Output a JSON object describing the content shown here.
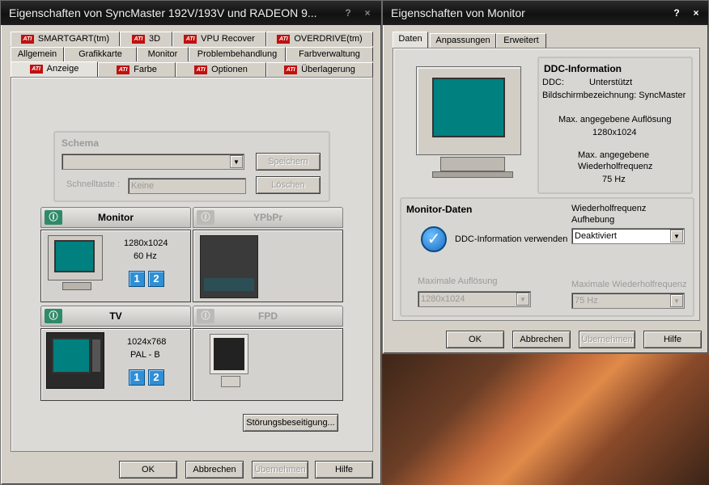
{
  "left_window": {
    "title": "Eigenschaften von  SyncMaster 192V/193V  und RADEON 9...",
    "help_btn": "?",
    "close_btn": "×",
    "tabs_row1": [
      "SMARTGART(tm)",
      "3D",
      "VPU Recover",
      "OVERDRIVE(tm)"
    ],
    "tabs_row2": [
      "Allgemein",
      "Grafikkarte",
      "Monitor",
      "Problembehandlung",
      "Farbverwaltung"
    ],
    "tabs_row3": [
      "Anzeige",
      "Farbe",
      "Optionen",
      "Überlagerung"
    ],
    "ati_logo": "ATI",
    "schema": {
      "title": "Schema",
      "save_btn": "Speichern",
      "hotkey_label": "Schnelltaste :",
      "hotkey_value": "Keine",
      "delete_btn": "Löschen"
    },
    "devices": {
      "monitor": {
        "name": "Monitor",
        "resolution": "1280x1024",
        "refresh": "60 Hz",
        "badge1": "1",
        "badge2": "2"
      },
      "ypbpr": {
        "name": "YPbPr"
      },
      "tv": {
        "name": "TV",
        "resolution": "1024x768",
        "standard": "PAL - B",
        "badge1": "1",
        "badge2": "2"
      },
      "fpd": {
        "name": "FPD"
      }
    },
    "power_symbol": "Ⓘ",
    "troubleshoot_btn": "Störungsbeseitigung...",
    "buttons": {
      "ok": "OK",
      "cancel": "Abbrechen",
      "apply": "Übernehmen",
      "help": "Hilfe"
    }
  },
  "right_window": {
    "title": "Eigenschaften von Monitor",
    "help_btn": "?",
    "close_btn": "×",
    "tabs": [
      "Daten",
      "Anpassungen",
      "Erweitert"
    ],
    "ddc": {
      "title": "DDC-Information",
      "ddc_label": "DDC:",
      "ddc_value": "Unterstützt",
      "screen_name": "Bildschirmbezeichnung: SyncMaster",
      "max_res_label": "Max. angegebene Auflösung",
      "max_res_value": "1280x1024",
      "max_freq_label1": "Max. angegebene",
      "max_freq_label2": "Wiederholfrequenz",
      "max_freq_value": "75 Hz"
    },
    "monitor_data": {
      "title": "Monitor-Daten",
      "use_ddc": "DDC-Information verwenden",
      "refresh_override_label1": "Wiederholfrequenz",
      "refresh_override_label2": "Aufhebung",
      "refresh_override_value": "Deaktiviert",
      "max_res_label": "Maximale Auflösung",
      "max_res_value": "1280x1024",
      "max_refresh_label": "Maximale Wiederholfrequenz",
      "max_refresh_value": "75 Hz"
    },
    "buttons": {
      "ok": "OK",
      "cancel": "Abbrechen",
      "apply": "Übernehmen",
      "help": "Hilfe"
    }
  }
}
